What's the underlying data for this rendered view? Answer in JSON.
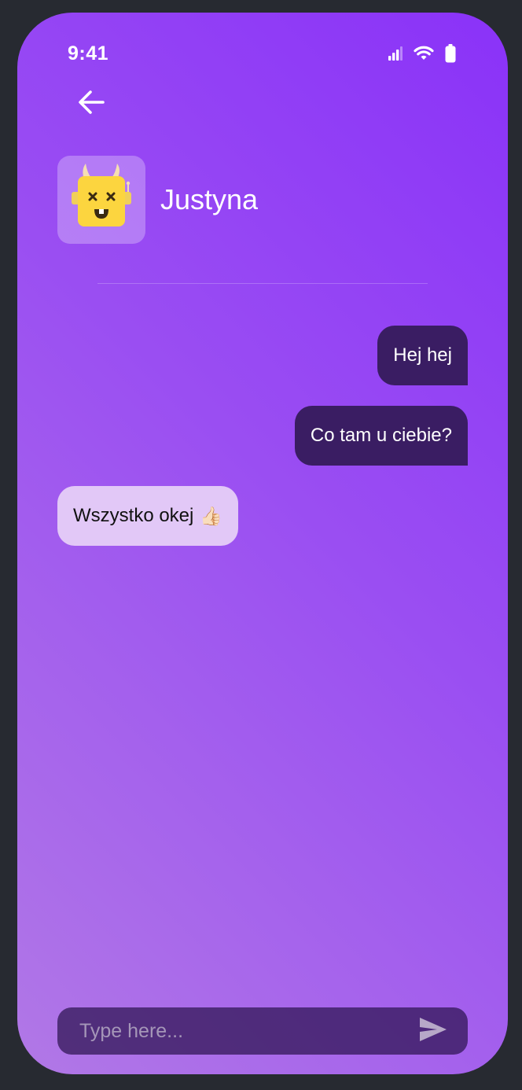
{
  "status_bar": {
    "time": "9:41",
    "icons": [
      "cellular-signal-icon",
      "wifi-icon",
      "battery-icon"
    ]
  },
  "header": {
    "back_icon": "arrow-left-icon",
    "contact_name": "Justyna",
    "avatar_icon": "yellow-monster-avatar"
  },
  "messages": [
    {
      "direction": "out",
      "text": "Hej hej"
    },
    {
      "direction": "out",
      "text": "Co tam u ciebie?"
    },
    {
      "direction": "in",
      "text": "Wszystko okej",
      "emoji": "👍🏻"
    }
  ],
  "composer": {
    "placeholder": "Type here...",
    "value": "",
    "send_icon": "send-icon"
  },
  "colors": {
    "background_outer": "#272a31",
    "gradient_start": "#8a32f8",
    "gradient_end": "#b178e6",
    "bubble_out": "#3a1d63",
    "bubble_in": "#e2c8f7",
    "avatar_yellow": "#fcd53f"
  }
}
